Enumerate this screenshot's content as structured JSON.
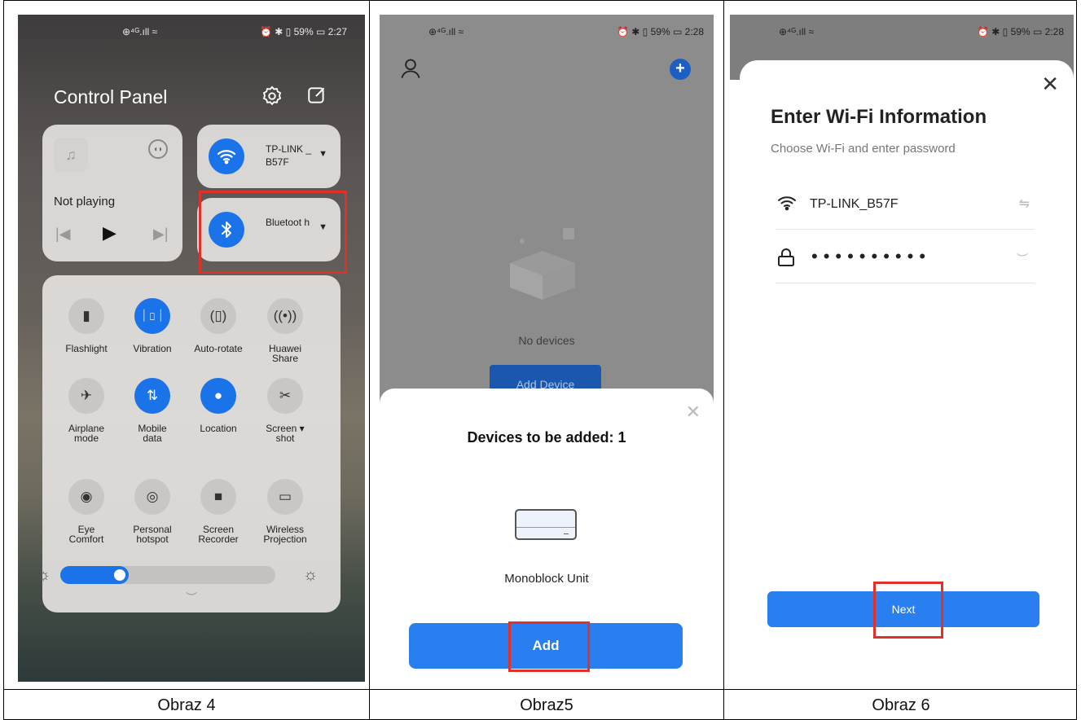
{
  "captions": [
    "Obraz 4",
    "Obraz5",
    "Obraz 6"
  ],
  "phone1": {
    "status": {
      "left": "⊕⁴ᴳ.ıll ≈",
      "right": "⏰ ✱ ▯ 59% ▭ 2:27"
    },
    "title": "Control Panel",
    "media": {
      "status": "Not playing"
    },
    "wifi": {
      "label": "TP-LINK _B57F"
    },
    "bluetooth": {
      "label": "Bluetoot h"
    },
    "toggles": [
      {
        "label": "Flashlight",
        "icon": "flashlight-icon",
        "glyph": "▮",
        "on": false
      },
      {
        "label": "Vibration",
        "icon": "vibration-icon",
        "glyph": "ᛁ▯ᛁ",
        "on": true
      },
      {
        "label": "Auto-rotate",
        "icon": "auto-rotate-icon",
        "glyph": "(▯)",
        "on": false
      },
      {
        "label": "Huawei Share",
        "icon": "huawei-share-icon",
        "glyph": "((•))",
        "on": false
      },
      {
        "label": "Airplane mode",
        "icon": "airplane-icon",
        "glyph": "✈",
        "on": false
      },
      {
        "label": "Mobile data",
        "icon": "mobile-data-icon",
        "glyph": "⇅",
        "on": true
      },
      {
        "label": "Location",
        "icon": "location-icon",
        "glyph": "●",
        "on": true
      },
      {
        "label": "Screen ▾ shot",
        "icon": "screenshot-icon",
        "glyph": "✂",
        "on": false
      },
      {
        "label": "Eye Comfort",
        "icon": "eye-comfort-icon",
        "glyph": "◉",
        "on": false
      },
      {
        "label": "Personal hotspot",
        "icon": "hotspot-icon",
        "glyph": "◎",
        "on": false
      },
      {
        "label": "Screen Recorder",
        "icon": "screen-recorder-icon",
        "glyph": "■",
        "on": false
      },
      {
        "label": "Wireless Projection",
        "icon": "wireless-projection-icon",
        "glyph": "▭",
        "on": false
      }
    ],
    "brightness": 0.32
  },
  "phone2": {
    "status": {
      "left": "⊕⁴ᴳ.ıll ≈",
      "right": "⏰ ✱ ▯ 59% ▭ 2:28"
    },
    "empty_text": "No devices",
    "add_device_label": "Add Device",
    "sheet_title": "Devices to be added: 1",
    "device_name": "Monoblock Unit",
    "add_label": "Add"
  },
  "phone3": {
    "status": {
      "left": "⊕⁴ᴳ.ıll ≈",
      "right": "⏰ ✱ ▯ 59% ▭ 2:28"
    },
    "title": "Enter Wi-Fi Information",
    "subtitle": "Choose Wi-Fi and enter password",
    "ssid": "TP-LINK_B57F",
    "password_mask": "••••••••••",
    "next_label": "Next"
  },
  "colors": {
    "accent": "#2a7ff0",
    "highlight": "#e0302a"
  }
}
